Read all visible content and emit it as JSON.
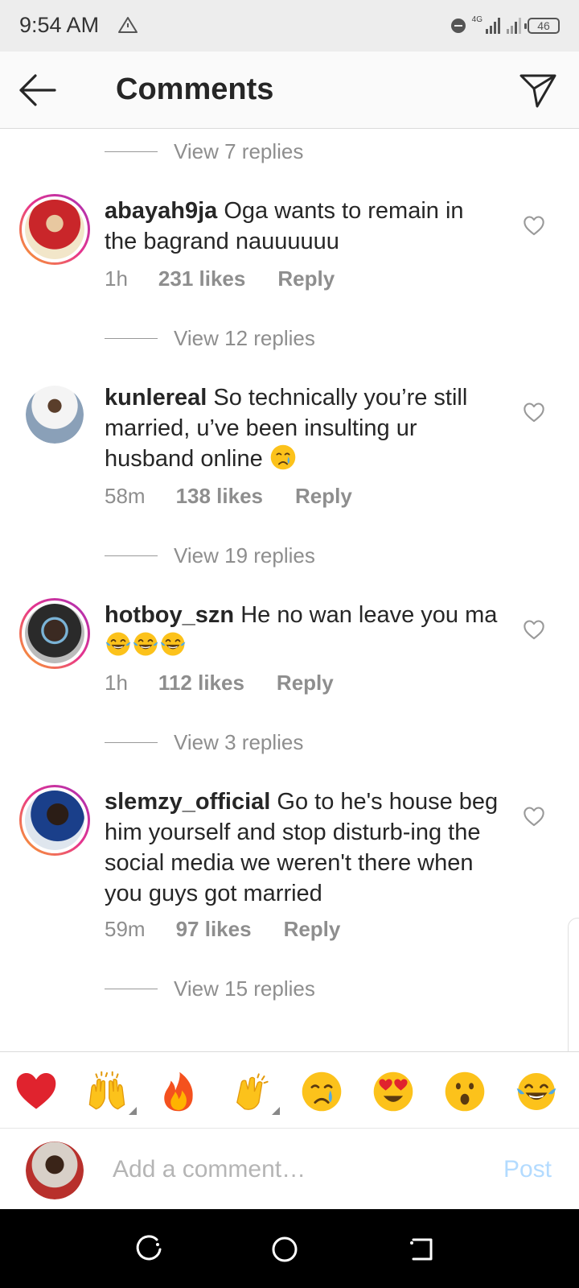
{
  "status_bar": {
    "time": "9:54 AM",
    "network": "4G",
    "battery": "46",
    "icons": [
      "warning-triangle-icon",
      "dnd-icon",
      "signal-icon",
      "battery-icon"
    ]
  },
  "header": {
    "title": "Comments",
    "back_icon": "arrow-left-icon",
    "send_icon": "paper-plane-icon"
  },
  "replies_top": "View 7 replies",
  "comments": [
    {
      "username": "abayah9ja",
      "text": "Oga wants to remain in the bagrand nauuuuuu",
      "time": "1h",
      "likes": "231 likes",
      "reply": "Reply",
      "view_replies": "View 12 replies",
      "has_story_ring": true
    },
    {
      "username": "kunlereal",
      "text": "So technically you’re still married, u’ve been insulting ur husband online",
      "emoji": [
        "crying-face"
      ],
      "time": "58m",
      "likes": "138 likes",
      "reply": "Reply",
      "view_replies": "View 19 replies",
      "has_story_ring": false
    },
    {
      "username": "hotboy_szn",
      "text": "He no wan leave you ma",
      "emoji": [
        "tears-of-joy",
        "tears-of-joy",
        "tears-of-joy"
      ],
      "time": "1h",
      "likes": "112 likes",
      "reply": "Reply",
      "view_replies": "View 3 replies",
      "has_story_ring": true
    },
    {
      "username": "slemzy_official",
      "text": "Go to he's house beg him yourself and stop disturb-ing the social media we weren't there when you guys got married",
      "time": "59m",
      "likes": "97 likes",
      "reply": "Reply",
      "view_replies": "View 15 replies",
      "has_story_ring": true
    }
  ],
  "emoji_bar": [
    "red-heart",
    "raising-hands",
    "fire",
    "clapping-hands",
    "crying-face",
    "heart-eyes",
    "surprised-face",
    "tears-of-joy"
  ],
  "add_comment": {
    "placeholder": "Add a comment…",
    "post_label": "Post"
  },
  "nav_bar": [
    "recents-icon",
    "home-icon",
    "back-icon"
  ],
  "colors": {
    "story_ring": [
      "#f9a826",
      "#e8358b",
      "#a62fb6"
    ],
    "post_disabled": "#b3dbff",
    "muted_text": "#8e8e8e",
    "heart_emoji": "#e0232e"
  }
}
